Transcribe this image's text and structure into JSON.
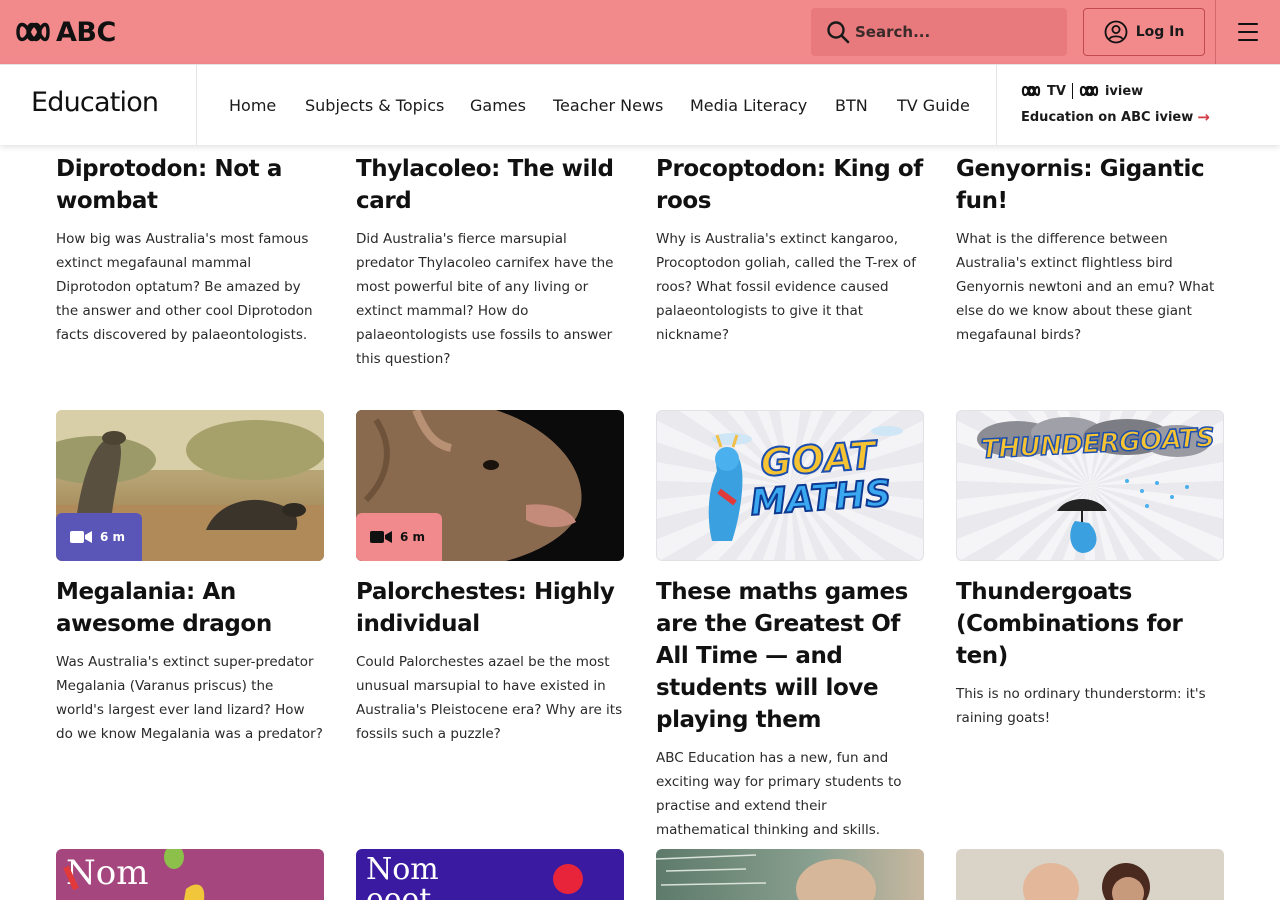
{
  "header": {
    "logo_text": "ABC",
    "search_placeholder": "Search...",
    "login_label": "Log In"
  },
  "section_nav": {
    "title": "Education",
    "links": [
      "Home",
      "Subjects & Topics",
      "Games",
      "Teacher News",
      "Media Literacy",
      "BTN",
      "TV Guide"
    ],
    "iview_logo_tv": "TV",
    "iview_logo_iview": "iview",
    "iview_link": "Education on ABC iview"
  },
  "cards_row1": [
    {
      "title_lines": [
        "Diprotodon: Not a",
        "wombat"
      ],
      "description": "How big was Australia's most famous extinct megafaunal mammal Diprotodon optatum? Be amazed by the answer and other cool Diprotodon facts discovered by palaeontologists."
    },
    {
      "title_lines": [
        "Thylacoleo: The wild",
        "card"
      ],
      "description": "Did Australia's fierce marsupial predator Thylacoleo carnifex have the most powerful bite of any living or extinct mammal? How do palaeontologists use fossils to answer this question?"
    },
    {
      "title_lines": [
        "Procoptodon: King of",
        "roos"
      ],
      "description": "Why is Australia's extinct kangaroo, Procoptodon goliah, called the T-rex of roos? What fossil evidence caused palaeontologists to give it that nickname?"
    },
    {
      "title_lines": [
        "Genyornis: Gigantic fun!"
      ],
      "description": "What is the difference between Australia's extinct flightless bird Genyornis newtoni and an emu? What else do we know about these giant megafaunal birds?"
    }
  ],
  "cards_row2": [
    {
      "title": "Megalania: An awesome dragon",
      "description": "Was Australia's extinct super-predator Megalania (Varanus priscus) the world's largest ever land lizard? How do we know Megalania was a predator?",
      "duration": "6 m",
      "badge_color": "#5a56b8"
    },
    {
      "title": "Palorchestes: Highly individual",
      "description": "Could Palorchestes azael be the most unusual marsupial to have existed in Australia's Pleistocene era? Why are its fossils such a puzzle?",
      "duration": "6 m",
      "badge_color": "#f08a8c"
    },
    {
      "title": "These maths games are the Greatest Of All Time — and students will love playing them",
      "description": "ABC Education has a new, fun and exciting way for primary students to practise and extend their mathematical thinking and skills.",
      "thumb_text_1": "GOAT",
      "thumb_text_2": "MATHS"
    },
    {
      "title": "Thundergoats (Combinations for ten)",
      "description": "This is no ordinary thunderstorm: it's raining goats!",
      "thumb_text": "THUNDERGOATS"
    }
  ],
  "cards_row3": [
    {
      "thumb_text": "Nom",
      "thumb_color": "#a6467e"
    },
    {
      "thumb_text": "Nom\neeet",
      "thumb_color": "#3a1aa0"
    },
    {
      "thumb_color": "#6e8a7a"
    },
    {
      "thumb_color": "#d9d3c8"
    }
  ],
  "colors": {
    "topbar": "#f28a8c",
    "accent_red": "#d23b45"
  }
}
